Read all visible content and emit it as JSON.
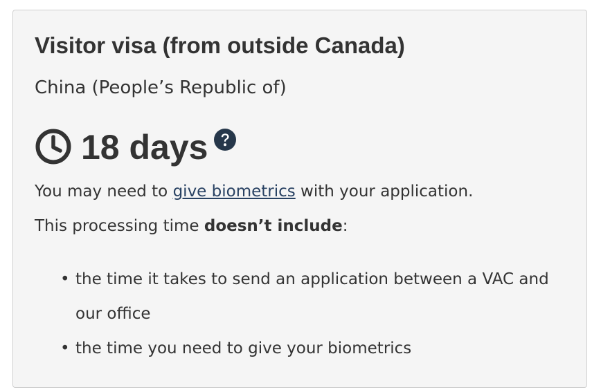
{
  "card": {
    "title": "Visitor visa (from outside Canada)",
    "country": "China (People’s Republic of)",
    "processing_time": "18 days",
    "icons": {
      "clock": "clock-icon",
      "help": "question-circle-icon"
    },
    "biometrics_line": {
      "before": "You may need to ",
      "link": "give biometrics",
      "after": " with your application."
    },
    "exclusions_line": {
      "before": "This processing time ",
      "bold": "doesn’t include",
      "after": ":"
    },
    "bullets": [
      "the time it takes to send an application between a VAC and our office",
      "the time you need to give your biometrics"
    ],
    "colors": {
      "panel_background": "#f5f5f5",
      "panel_border": "#cfcfcf",
      "text": "#333333",
      "link": "#284162",
      "help_icon": "#26374a"
    }
  }
}
